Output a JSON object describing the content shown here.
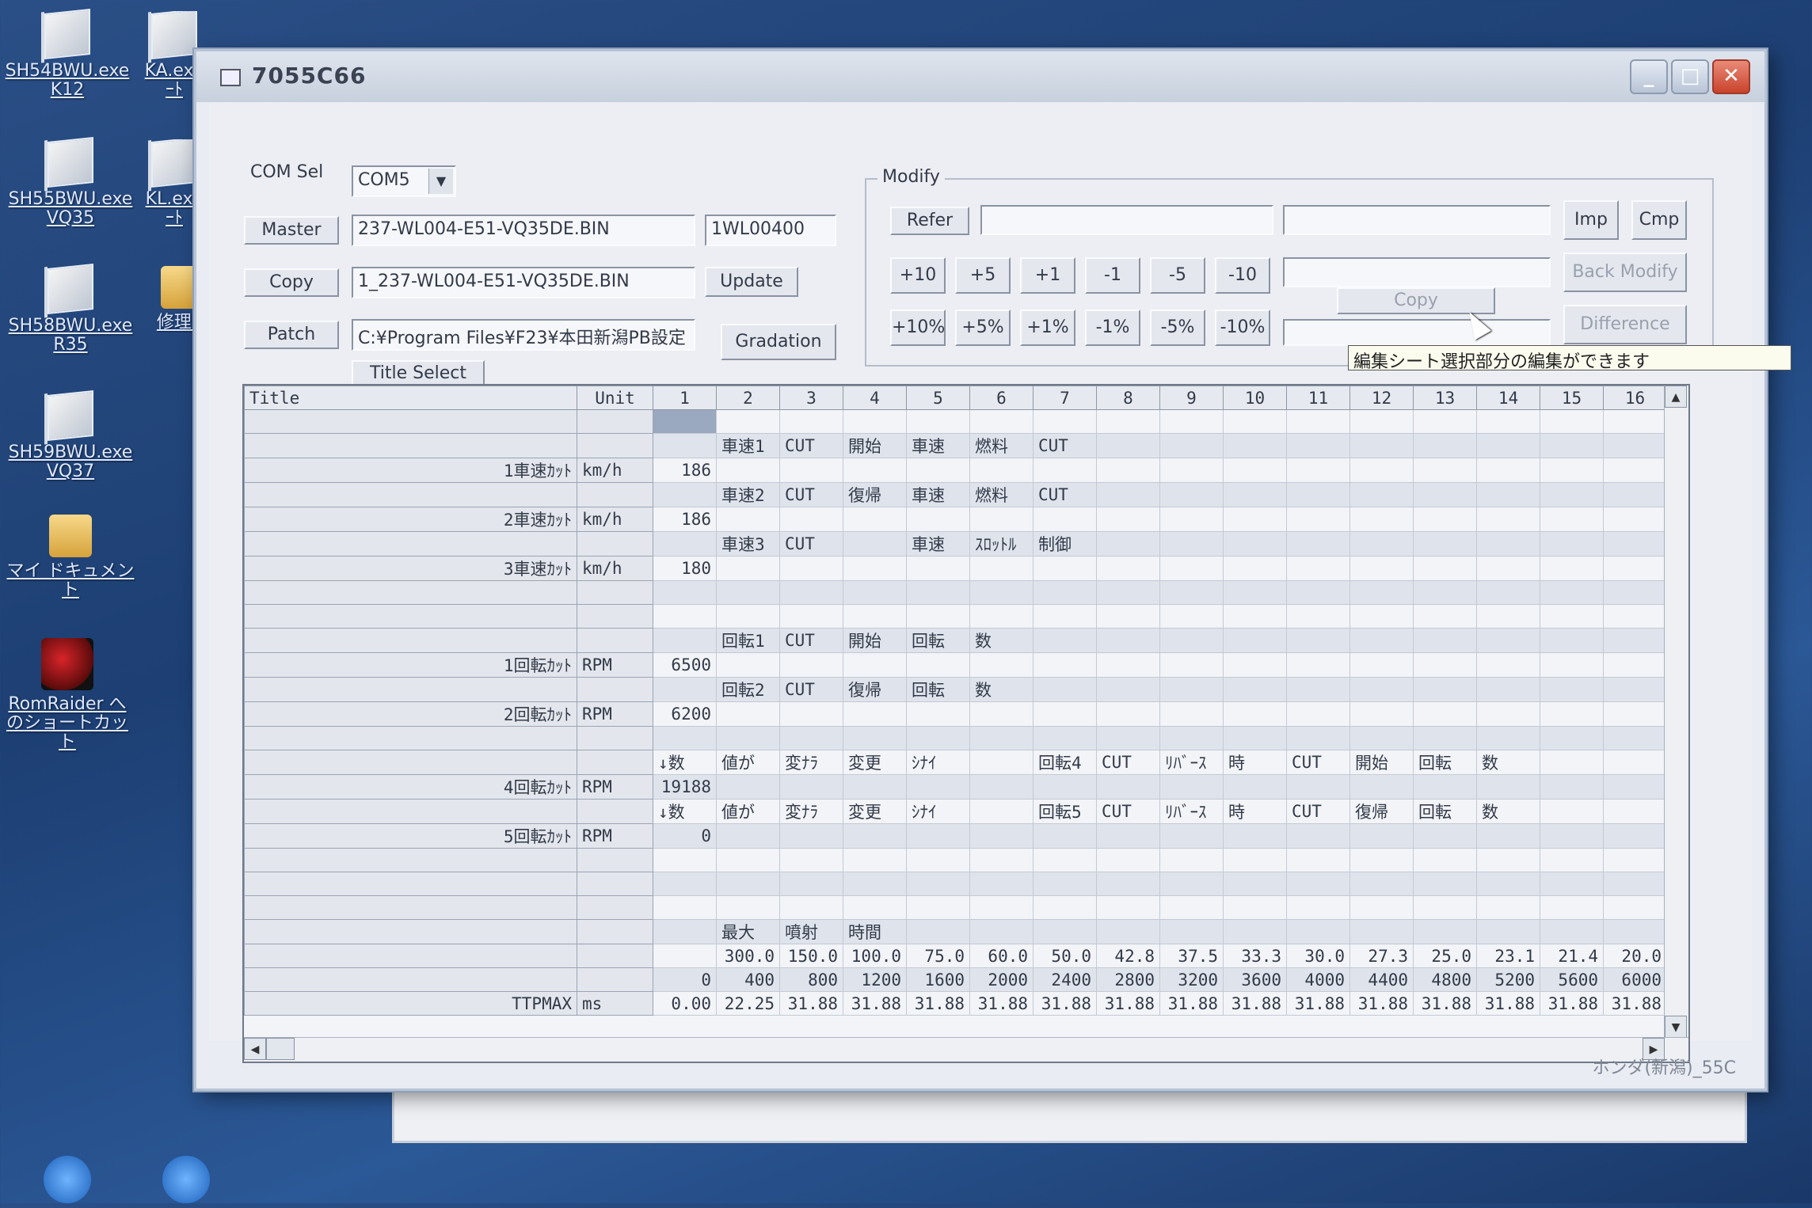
{
  "desktop": {
    "icons": [
      {
        "label": "SH54BWU.exe K12"
      },
      {
        "label": "KA.exe ｰﾄ"
      },
      {
        "label": "SH55BWU.exe VQ35"
      },
      {
        "label": "KL.exe ｰﾄ"
      },
      {
        "label": "SH58BWU.exe R35"
      },
      {
        "label": "修理 P"
      },
      {
        "label": "SH59BWU.exe VQ37"
      },
      {
        "label": "マイ ドキュメント"
      },
      {
        "label": "RomRaider へのショートカット"
      }
    ]
  },
  "window": {
    "title": "7055C66",
    "com_sel_label": "COM Sel",
    "com_port": "COM5",
    "master_label": "Master",
    "master_file": "237-WL004-E51-VQ35DE.BIN",
    "master_id": "1WL00400",
    "copy_label": "Copy",
    "copy_file": "1_237-WL004-E51-VQ35DE.BIN",
    "update_label": "Update",
    "patch_label": "Patch",
    "patch_path": "C:¥Program Files¥F23¥本田新潟PB設定",
    "gradation_label": "Gradation",
    "title_select_label": "Title Select",
    "status_text": "ホンダ(新潟)_55C"
  },
  "modify": {
    "group_title": "Modify",
    "refer_label": "Refer",
    "imp_label": "Imp",
    "cmp_label": "Cmp",
    "back_modify_label": "Back Modify",
    "copy_label": "Copy",
    "difference_label": "Difference",
    "inc_buttons": [
      "+10",
      "+5",
      "+1",
      "-1",
      "-5",
      "-10"
    ],
    "pct_buttons": [
      "+10%",
      "+5%",
      "+1%",
      "-1%",
      "-5%",
      "-10%"
    ]
  },
  "grid": {
    "headers": [
      "Title",
      "Unit",
      "1",
      "2",
      "3",
      "4",
      "5",
      "6",
      "7",
      "8",
      "9",
      "10",
      "11",
      "12",
      "13",
      "14",
      "15",
      "16"
    ],
    "rows": [
      [
        "",
        "",
        "",
        "",
        "",
        "",
        "",
        "",
        "",
        "",
        "",
        "",
        "",
        "",
        "",
        "",
        "",
        ""
      ],
      [
        "",
        "",
        "",
        "車速1",
        "CUT",
        "開始",
        "車速",
        "燃料",
        "CUT",
        "",
        "",
        "",
        "",
        "",
        "",
        "",
        "",
        ""
      ],
      [
        "1車速ｶｯﾄ",
        "km/h",
        "186",
        "",
        "",
        "",
        "",
        "",
        "",
        "",
        "",
        "",
        "",
        "",
        "",
        "",
        "",
        ""
      ],
      [
        "",
        "",
        "",
        "車速2",
        "CUT",
        "復帰",
        "車速",
        "燃料",
        "CUT",
        "",
        "",
        "",
        "",
        "",
        "",
        "",
        "",
        ""
      ],
      [
        "2車速ｶｯﾄ",
        "km/h",
        "186",
        "",
        "",
        "",
        "",
        "",
        "",
        "",
        "",
        "",
        "",
        "",
        "",
        "",
        "",
        ""
      ],
      [
        "",
        "",
        "",
        "車速3",
        "CUT",
        "",
        "車速",
        "ｽﾛｯﾄﾙ",
        "制御",
        "",
        "",
        "",
        "",
        "",
        "",
        "",
        "",
        ""
      ],
      [
        "3車速ｶｯﾄ",
        "km/h",
        "180",
        "",
        "",
        "",
        "",
        "",
        "",
        "",
        "",
        "",
        "",
        "",
        "",
        "",
        "",
        ""
      ],
      [
        "",
        "",
        "",
        "",
        "",
        "",
        "",
        "",
        "",
        "",
        "",
        "",
        "",
        "",
        "",
        "",
        "",
        ""
      ],
      [
        "",
        "",
        "",
        "",
        "",
        "",
        "",
        "",
        "",
        "",
        "",
        "",
        "",
        "",
        "",
        "",
        "",
        ""
      ],
      [
        "",
        "",
        "",
        "回転1",
        "CUT",
        "開始",
        "回転",
        "数",
        "",
        "",
        "",
        "",
        "",
        "",
        "",
        "",
        "",
        ""
      ],
      [
        "1回転ｶｯﾄ",
        "RPM",
        "6500",
        "",
        "",
        "",
        "",
        "",
        "",
        "",
        "",
        "",
        "",
        "",
        "",
        "",
        "",
        ""
      ],
      [
        "",
        "",
        "",
        "回転2",
        "CUT",
        "復帰",
        "回転",
        "数",
        "",
        "",
        "",
        "",
        "",
        "",
        "",
        "",
        "",
        ""
      ],
      [
        "2回転ｶｯﾄ",
        "RPM",
        "6200",
        "",
        "",
        "",
        "",
        "",
        "",
        "",
        "",
        "",
        "",
        "",
        "",
        "",
        "",
        ""
      ],
      [
        "",
        "",
        "",
        "",
        "",
        "",
        "",
        "",
        "",
        "",
        "",
        "",
        "",
        "",
        "",
        "",
        "",
        ""
      ],
      [
        "",
        "",
        "↓数",
        "値が",
        "変ﾅﾗ",
        "変更",
        "ｼﾅｲ",
        "",
        "回転4",
        "CUT",
        "ﾘﾊﾞｰｽ",
        "時",
        "CUT",
        "開始",
        "回転",
        "数",
        "",
        ""
      ],
      [
        "4回転ｶｯﾄ",
        "RPM",
        "19188",
        "",
        "",
        "",
        "",
        "",
        "",
        "",
        "",
        "",
        "",
        "",
        "",
        "",
        "",
        ""
      ],
      [
        "",
        "",
        "↓数",
        "値が",
        "変ﾅﾗ",
        "変更",
        "ｼﾅｲ",
        "",
        "回転5",
        "CUT",
        "ﾘﾊﾞｰｽ",
        "時",
        "CUT",
        "復帰",
        "回転",
        "数",
        "",
        ""
      ],
      [
        "5回転ｶｯﾄ",
        "RPM",
        "0",
        "",
        "",
        "",
        "",
        "",
        "",
        "",
        "",
        "",
        "",
        "",
        "",
        "",
        "",
        ""
      ],
      [
        "",
        "",
        "",
        "",
        "",
        "",
        "",
        "",
        "",
        "",
        "",
        "",
        "",
        "",
        "",
        "",
        "",
        ""
      ],
      [
        "",
        "",
        "",
        "",
        "",
        "",
        "",
        "",
        "",
        "",
        "",
        "",
        "",
        "",
        "",
        "",
        "",
        ""
      ],
      [
        "",
        "",
        "",
        "",
        "",
        "",
        "",
        "",
        "",
        "",
        "",
        "",
        "",
        "",
        "",
        "",
        "",
        ""
      ],
      [
        "",
        "",
        "",
        "最大",
        "噴射",
        "時間",
        "",
        "",
        "",
        "",
        "",
        "",
        "",
        "",
        "",
        "",
        "",
        ""
      ],
      [
        "",
        "",
        "",
        "300.0",
        "150.0",
        "100.0",
        "75.0",
        "60.0",
        "50.0",
        "42.8",
        "37.5",
        "33.3",
        "30.0",
        "27.3",
        "25.0",
        "23.1",
        "21.4",
        "20.0"
      ],
      [
        "",
        "",
        "0",
        "400",
        "800",
        "1200",
        "1600",
        "2000",
        "2400",
        "2800",
        "3200",
        "3600",
        "4000",
        "4400",
        "4800",
        "5200",
        "5600",
        "6000"
      ],
      [
        "TTPMAX",
        "ms",
        "0.00",
        "22.25",
        "31.88",
        "31.88",
        "31.88",
        "31.88",
        "31.88",
        "31.88",
        "31.88",
        "31.88",
        "31.88",
        "31.88",
        "31.88",
        "31.88",
        "31.88",
        "31.88"
      ]
    ]
  },
  "tooltip": {
    "text": "編集シート選択部分の編集ができます"
  }
}
